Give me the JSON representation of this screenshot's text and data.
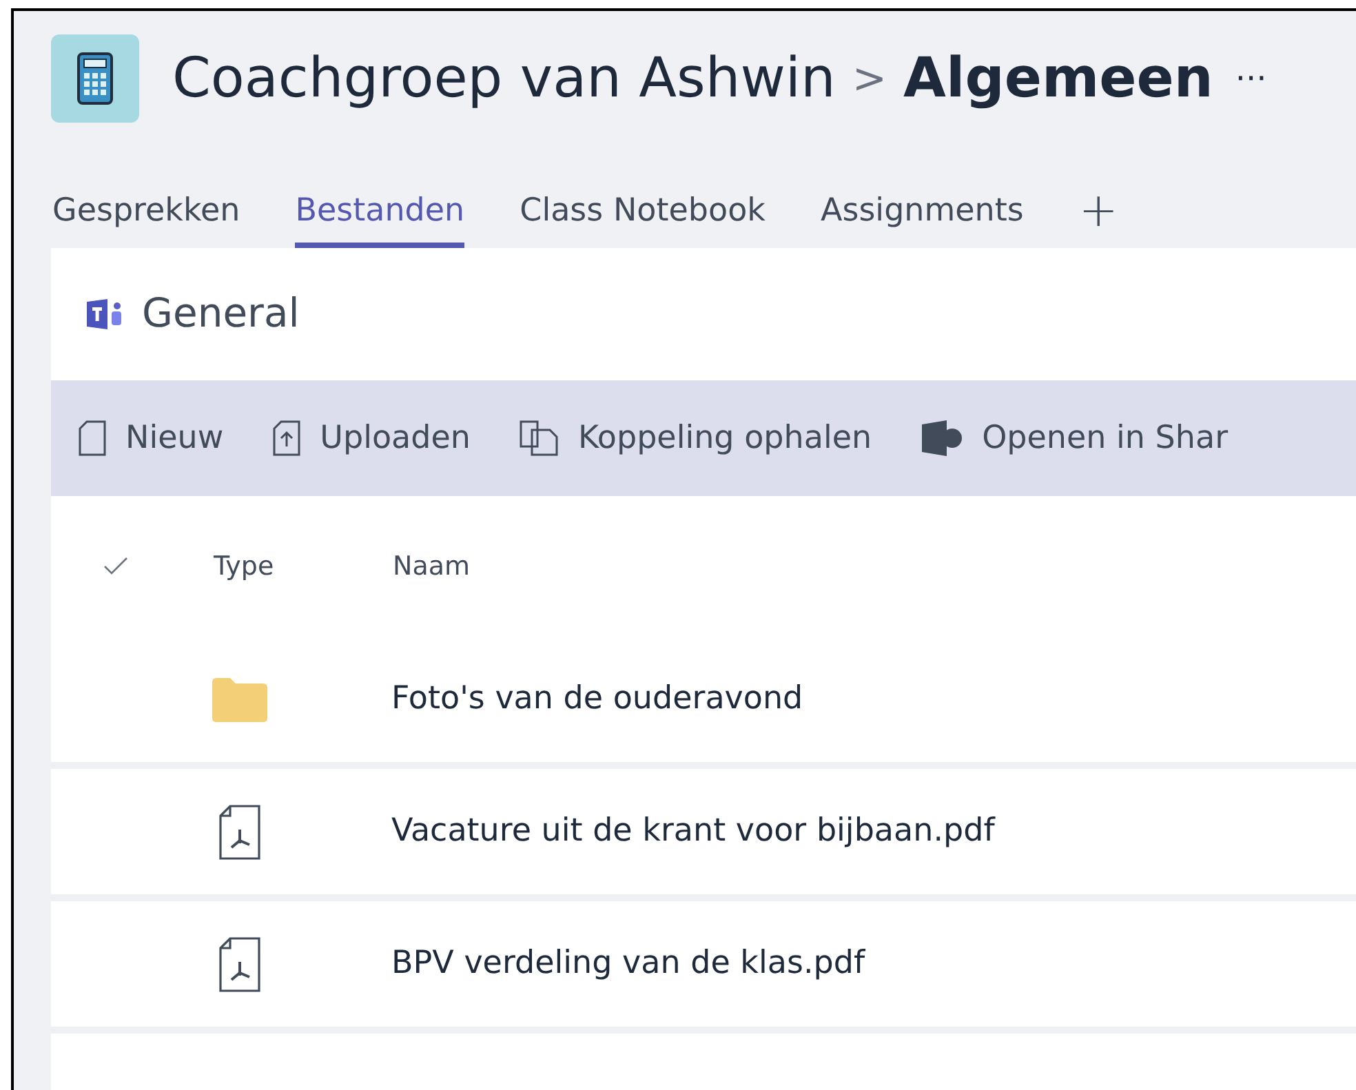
{
  "header": {
    "team": "Coachgroep van Ashwin",
    "separator": ">",
    "channel": "Algemeen",
    "more": "···"
  },
  "tabs": [
    {
      "label": "Gesprekken",
      "selected": false
    },
    {
      "label": "Bestanden",
      "selected": true
    },
    {
      "label": "Class Notebook",
      "selected": false
    },
    {
      "label": "Assignments",
      "selected": false
    }
  ],
  "add_tab": "+",
  "section_title": "General",
  "toolbar": [
    {
      "kind": "new",
      "label": "Nieuw"
    },
    {
      "kind": "upload",
      "label": "Uploaden"
    },
    {
      "kind": "link",
      "label": "Koppeling ophalen"
    },
    {
      "kind": "sharepoint",
      "label": "Openen in Shar"
    }
  ],
  "table": {
    "columns": [
      "Type",
      "Naam"
    ],
    "rows": [
      {
        "kind": "folder",
        "name": "Foto's van de ouderavond"
      },
      {
        "kind": "pdf",
        "name": "Vacature uit de krant voor bijbaan.pdf"
      },
      {
        "kind": "pdf",
        "name": "BPV verdeling van de klas.pdf"
      }
    ]
  }
}
